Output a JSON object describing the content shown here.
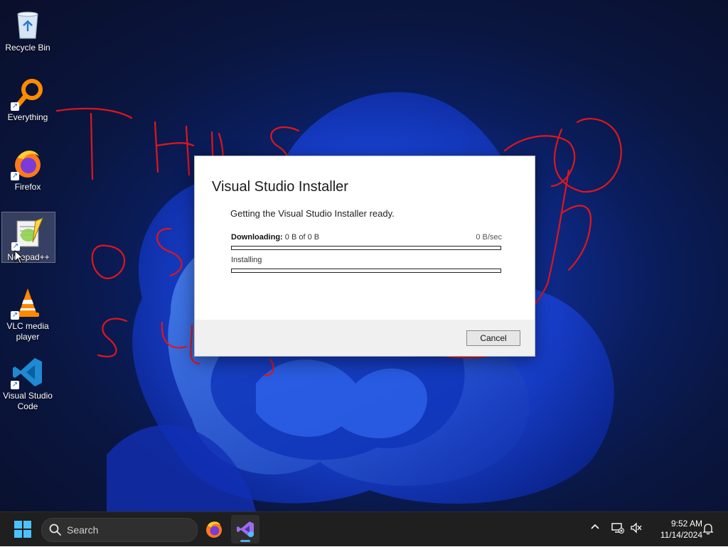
{
  "desktop_icons": [
    {
      "label": "Recycle Bin",
      "icon": "recycle-bin-icon"
    },
    {
      "label": "Everything",
      "icon": "everything-search-icon"
    },
    {
      "label": "Firefox",
      "icon": "firefox-icon"
    },
    {
      "label": "Notepad++",
      "icon": "notepad-plus-plus-icon"
    },
    {
      "label": "VLC media\nplayer",
      "icon": "vlc-icon"
    },
    {
      "label": "Visual Studio\nCode",
      "icon": "vscode-icon"
    }
  ],
  "dialog": {
    "title": "Visual Studio Installer",
    "message": "Getting the Visual Studio Installer ready.",
    "download_label": "Downloading:",
    "download_value": "0 B of 0 B",
    "download_rate": "0 B/sec",
    "download_progress": 0,
    "install_label": "Installing",
    "install_progress": 0,
    "cancel_label": "Cancel"
  },
  "taskbar": {
    "search_placeholder": "Search",
    "apps": [
      {
        "name": "Firefox",
        "icon": "firefox-icon",
        "active": false
      },
      {
        "name": "Visual Studio Installer",
        "icon": "visual-studio-icon",
        "active": true
      }
    ],
    "time": "9:52 AM",
    "date": "11/14/2024"
  },
  "colors": {
    "accent": "#1e6fd6",
    "taskbar_bg": "#1f1f1f",
    "scribble": "#e0161d"
  }
}
